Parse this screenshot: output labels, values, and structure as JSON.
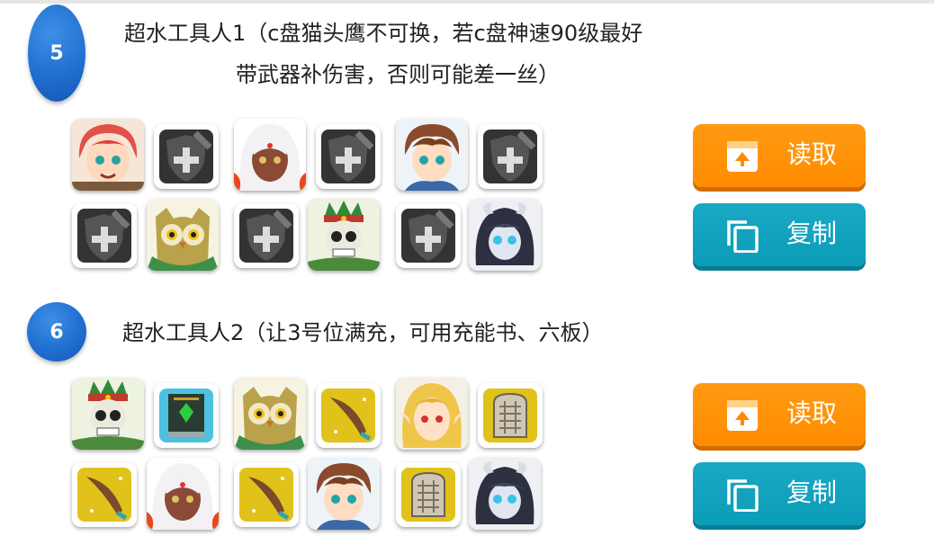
{
  "sections": [
    {
      "number": "5",
      "title_line1": "超水工具人1（c盘猫头鹰不可换，若c盘神速90级最好",
      "title_line2": "带武器补伤害，否则可能差一丝）",
      "read_label": "读取",
      "copy_label": "复制"
    },
    {
      "number": "6",
      "title_line1": "超水工具人2（让3号位满充，可用充能书、六板）",
      "read_label": "读取",
      "copy_label": "复制"
    }
  ],
  "colors": {
    "badge_blue": "#1f6fd0",
    "read_button": "#ff8c00",
    "copy_button": "#0b9cb8"
  },
  "icons": {
    "read": "tray-upload-icon",
    "copy": "copy-icon",
    "empty_slot": "empty-weapon-slot-icon"
  }
}
